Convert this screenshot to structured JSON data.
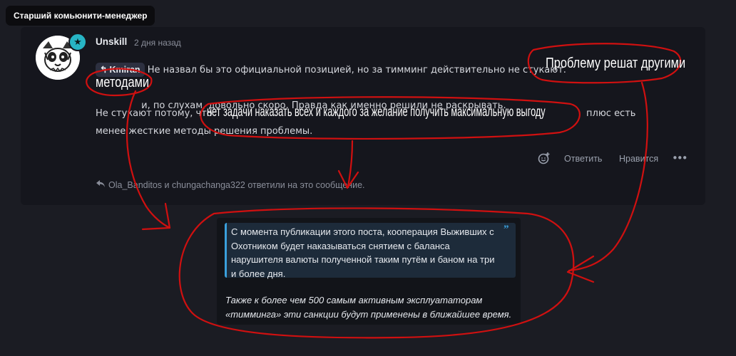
{
  "tooltip": "Старший комьюнити-менеджер",
  "post": {
    "author": "Unskill",
    "time": "2 дня назад",
    "mention": "Kmiran",
    "para1": "Не назвал бы это официальной позицией, но за тимминг действительно не стукают.",
    "para1_after": "и, по слухам, довольно скоро. Правда как именно решили не раскрывать.",
    "para2_before": "Не стукают потому, что",
    "para2_after": "плюс есть менее жесткие методы решения проблемы.",
    "actions": {
      "reply": "Ответить",
      "like": "Нравится",
      "more": "•••"
    },
    "replied_by": "Ola_Banditos и chungachanga322 ответили на это сообщение."
  },
  "quote": {
    "text": "С момента публикации этого поста, кооперация Выживших с Охотником будет наказываться снятием с баланса нарушителя валюты полученной таким путём и баном на три и более дня.",
    "italic": "Также к более чем 500 самым активным эксплуататорам «тимминга» эти санкции будут применены в ближайшее время."
  },
  "annotations": {
    "note1_line1": "Проблему решат другими",
    "note1_line2": "методами",
    "note2": "нет задачи наказать всех и каждого за желание получить максимальную выгоду",
    "ink_color": "#d01010"
  },
  "icons": {
    "role": "star-icon",
    "mention": "reply-arrow-icon",
    "react": "emoji-add-icon",
    "replied": "reply-arrow-icon"
  }
}
